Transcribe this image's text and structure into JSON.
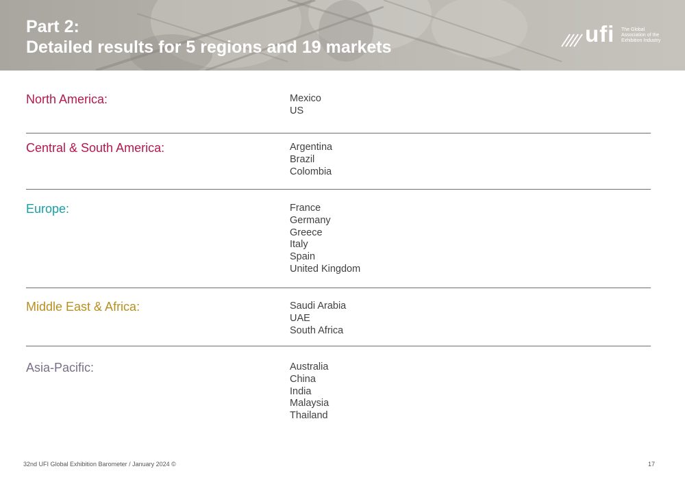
{
  "header": {
    "title_line1": "Part 2:",
    "title_line2": "Detailed results for 5 regions and 19 markets"
  },
  "logo": {
    "wordmark": "ufi",
    "tagline": "The Global\nAssociation of the\nExhibition Industry"
  },
  "colors": {
    "north_america": "#b5174f",
    "central_south_america": "#b5174f",
    "europe": "#16a0a6",
    "middle_east_africa": "#b88f1f",
    "asia_pacific": "#7a6f86"
  },
  "regions": [
    {
      "name": "North America:",
      "markets": [
        "Mexico",
        "US"
      ]
    },
    {
      "name": "Central & South America:",
      "markets": [
        "Argentina",
        "Brazil",
        "Colombia"
      ]
    },
    {
      "name": "Europe:",
      "markets": [
        "France",
        "Germany",
        "Greece",
        "Italy",
        "Spain",
        "United Kingdom"
      ]
    },
    {
      "name": "Middle East & Africa:",
      "markets": [
        "Saudi Arabia",
        "UAE",
        "South Africa"
      ]
    },
    {
      "name": "Asia-Pacific:",
      "markets": [
        "Australia",
        "China",
        "India",
        "Malaysia",
        "Thailand"
      ]
    }
  ],
  "footer": {
    "source": "32nd UFI Global Exhibition Barometer / January 2024 ©",
    "page_number": "17"
  }
}
